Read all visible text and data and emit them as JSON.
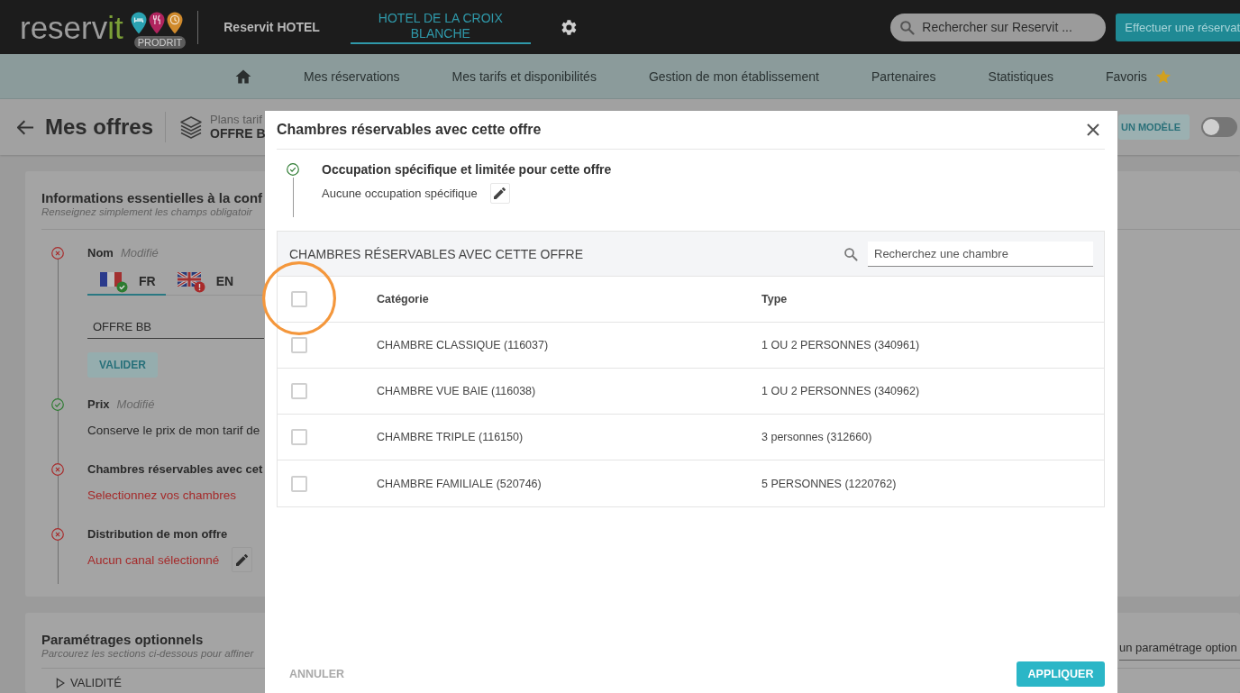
{
  "top_bar": {
    "logo": {
      "text": "reservit",
      "tag": "PRODRIT"
    },
    "account": "Reservit HOTEL",
    "hotel": "HOTEL DE LA CROIX BLANCHE",
    "search": {
      "placeholder": "Rechercher sur Reservit ..."
    },
    "action_button": "Effectuer une réservat"
  },
  "nav": {
    "items": [
      {
        "label": "Mes réservations",
        "kind": "link"
      },
      {
        "label": "Mes tarifs et disponibilités",
        "kind": "link"
      },
      {
        "label": "Gestion de mon établissement",
        "kind": "link"
      },
      {
        "label": "Partenaires",
        "kind": "link"
      },
      {
        "label": "Statistiques",
        "kind": "link"
      },
      {
        "label": "Favoris",
        "kind": "favorites"
      }
    ]
  },
  "page_header": {
    "title": "Mes offres",
    "plan_label": "Plans tarif",
    "plan_name": "OFFRE B",
    "template_button": "UN MODÈLE",
    "toggle": {
      "on": false
    }
  },
  "essentials": {
    "title": "Informations essentielles à la conf",
    "subtitle": "Renseignez simplement les champs obligatoir",
    "steps": [
      {
        "kind": "name",
        "valid": false,
        "label": "Nom",
        "note": "Modifié",
        "languages": [
          {
            "code": "FR",
            "kind": "fr",
            "valid": true,
            "selected": true
          },
          {
            "code": "EN",
            "kind": "uk",
            "valid": false,
            "selected": false
          }
        ],
        "value": "OFFRE BB",
        "button": "VALIDER"
      },
      {
        "kind": "text",
        "valid": true,
        "label": "Prix",
        "note": "Modifié",
        "text": "Conserve le prix de mon tarif de",
        "editable": false
      },
      {
        "kind": "text",
        "valid": false,
        "label": "Chambres réservables avec cet",
        "text": "Selectionnez vos chambres",
        "editable": false
      },
      {
        "kind": "text",
        "valid": false,
        "label": "Distribution de mon offre",
        "text": "Aucun canal sélectionné",
        "editable": true
      }
    ]
  },
  "optional": {
    "title": "Paramétrages optionnels",
    "subtitle": "Parcourez les sections ci-dessous pour affiner",
    "add": {
      "placeholder": "un paramétrage option"
    },
    "sections": [
      {
        "label": "VALIDITÉ",
        "expanded": false
      }
    ]
  },
  "modal": {
    "title": "Chambres réservables avec cette offre",
    "occupancy": {
      "valid": true,
      "title": "Occupation spécifique et limitée pour cette offre",
      "text": "Aucune occupation spécifique"
    },
    "rooms": {
      "heading": "CHAMBRES RÉSERVABLES AVEC CETTE OFFRE",
      "search": {
        "placeholder": "Recherchez une chambre"
      },
      "select_all": {
        "checked": false,
        "highlighted": true
      },
      "columns": [
        "Catégorie",
        "Type"
      ],
      "rows": [
        {
          "category": "CHAMBRE CLASSIQUE (116037)",
          "type": "1 OU 2 PERSONNES (340961)",
          "checked": false
        },
        {
          "category": "CHAMBRE VUE BAIE (116038)",
          "type": "1 OU 2 PERSONNES (340962)",
          "checked": false
        },
        {
          "category": "CHAMBRE TRIPLE (116150)",
          "type": "3 personnes (312660)",
          "checked": false
        },
        {
          "category": "CHAMBRE FAMILIALE (520746)",
          "type": "5 PERSONNES (1220762)",
          "checked": false
        }
      ]
    },
    "cancel_button": "ANNULER",
    "apply_button": "APPLIQUER"
  }
}
